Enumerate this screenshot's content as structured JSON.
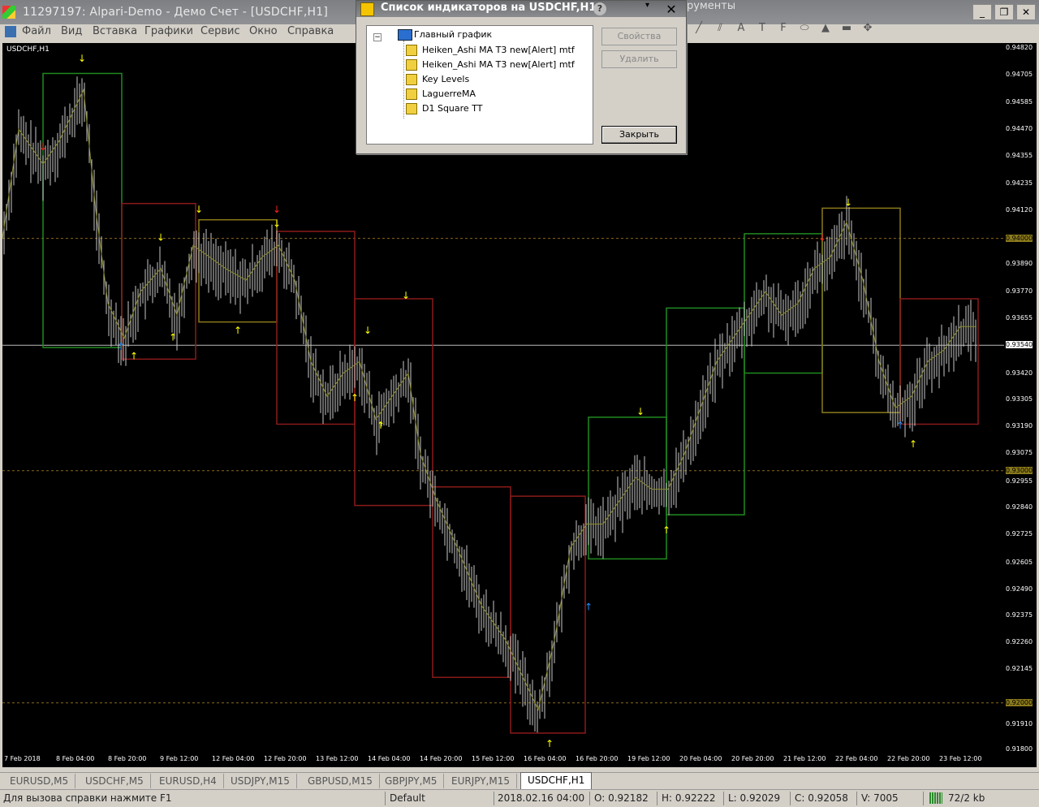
{
  "window": {
    "title": "11297197: Alpari-Demo - Демо Счет - [USDCHF,H1]",
    "partial_right_title": "рументы"
  },
  "menu": {
    "items": [
      "Файл",
      "Вид",
      "Вставка",
      "Графики",
      "Сервис",
      "Окно",
      "Справка"
    ]
  },
  "chart": {
    "symbol_label": "USDCHF,H1",
    "price_labels": [
      "0.94820",
      "0.94705",
      "0.94585",
      "0.94470",
      "0.94355",
      "0.94235",
      "0.94120",
      "0.94000",
      "0.93890",
      "0.93770",
      "0.93655",
      "0.93540",
      "0.93420",
      "0.93305",
      "0.93190",
      "0.93075",
      "0.93000",
      "0.92955",
      "0.92840",
      "0.92725",
      "0.92605",
      "0.92490",
      "0.92375",
      "0.92260",
      "0.92145",
      "0.92000",
      "0.91910",
      "0.91800"
    ],
    "time_labels": [
      "7 Feb 2018",
      "8 Feb 04:00",
      "8 Feb 20:00",
      "9 Feb 12:00",
      "12 Feb 04:00",
      "12 Feb 20:00",
      "13 Feb 12:00",
      "14 Feb 04:00",
      "14 Feb 20:00",
      "15 Feb 12:00",
      "16 Feb 04:00",
      "16 Feb 20:00",
      "19 Feb 12:00",
      "20 Feb 04:00",
      "20 Feb 20:00",
      "21 Feb 12:00",
      "22 Feb 04:00",
      "22 Feb 20:00",
      "23 Feb 12:00"
    ],
    "highlight_levels": [
      "0.94000",
      "0.93000",
      "0.92000"
    ],
    "current_price": "0.93540",
    "colors": {
      "up_box": "#1f8a1f",
      "down_box": "#8a1a1a",
      "neutral_box": "#8a7a1a",
      "bars": "#c8c8c8",
      "level_line": "#8b6a1c",
      "arrow_up_yellow": "#ffff00",
      "arrow_blue": "#1e90ff",
      "arrow_red": "#ff2020"
    }
  },
  "dialog": {
    "title": "Список индикаторов на USDCHF,H1",
    "root": "Главный график",
    "indicators": [
      "Heiken_Ashi MA T3 new[Alert] mtf",
      "Heiken_Ashi MA T3 new[Alert] mtf",
      "Key Levels",
      "LaguerreMA",
      "D1 Square TT"
    ],
    "buttons": {
      "properties": "Свойства",
      "delete": "Удалить",
      "close": "Закрыть"
    },
    "help_icon": "?",
    "close_icon": "✕",
    "dropdown_icon": "▾"
  },
  "tabs": {
    "items": [
      "EURUSD,M5",
      "USDCHF,M5",
      "EURUSD,H4",
      "USDJPY,M15",
      "GBPUSD,M15",
      "GBPJPY,M5",
      "EURJPY,M15",
      "USDCHF,H1"
    ],
    "active": "USDCHF,H1"
  },
  "status": {
    "help": "Для вызова справки нажмите F1",
    "profile": "Default",
    "datetime": "2018.02.16 04:00",
    "open": "O: 0.92182",
    "high": "H: 0.92222",
    "low": "L: 0.92029",
    "close": "C: 0.92058",
    "volume": "V: 7005",
    "traffic": "72/2 kb"
  }
}
